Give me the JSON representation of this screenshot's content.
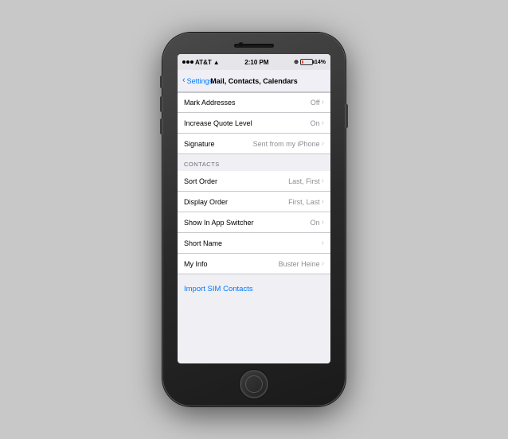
{
  "statusBar": {
    "carrier": "AT&T",
    "signalLabel": "signal",
    "time": "2:10 PM",
    "battery_percent": "14%"
  },
  "navBar": {
    "backLabel": "Settings",
    "title": "Mail, Contacts, Calendars"
  },
  "mailSection": {
    "cells": [
      {
        "label": "Mark Addresses",
        "value": "Off"
      },
      {
        "label": "Increase Quote Level",
        "value": "On"
      },
      {
        "label": "Signature",
        "value": "Sent from my iPhone"
      }
    ]
  },
  "contactsSection": {
    "header": "CONTACTS",
    "cells": [
      {
        "label": "Sort Order",
        "value": "Last, First"
      },
      {
        "label": "Display Order",
        "value": "First, Last"
      },
      {
        "label": "Show In App Switcher",
        "value": "On"
      },
      {
        "label": "Short Name",
        "value": ""
      },
      {
        "label": "My Info",
        "value": "Buster Heine"
      }
    ]
  },
  "importSection": {
    "linkLabel": "Import SIM Contacts"
  }
}
